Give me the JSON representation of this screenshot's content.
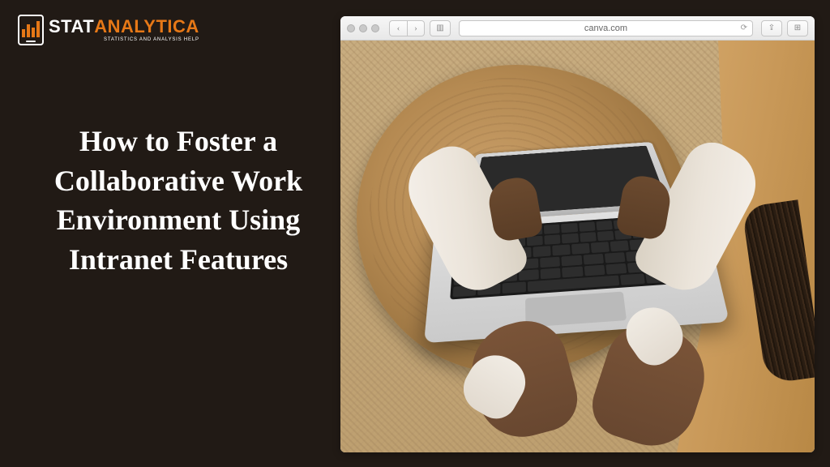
{
  "logo": {
    "stat": "STAT",
    "analytica": "ANALYTICA",
    "tagline": "STATISTICS AND ANALYSIS HELP"
  },
  "headline": "How to Foster a Collaborative Work Environment Using Intranet Features",
  "browser": {
    "url": "canva.com"
  }
}
